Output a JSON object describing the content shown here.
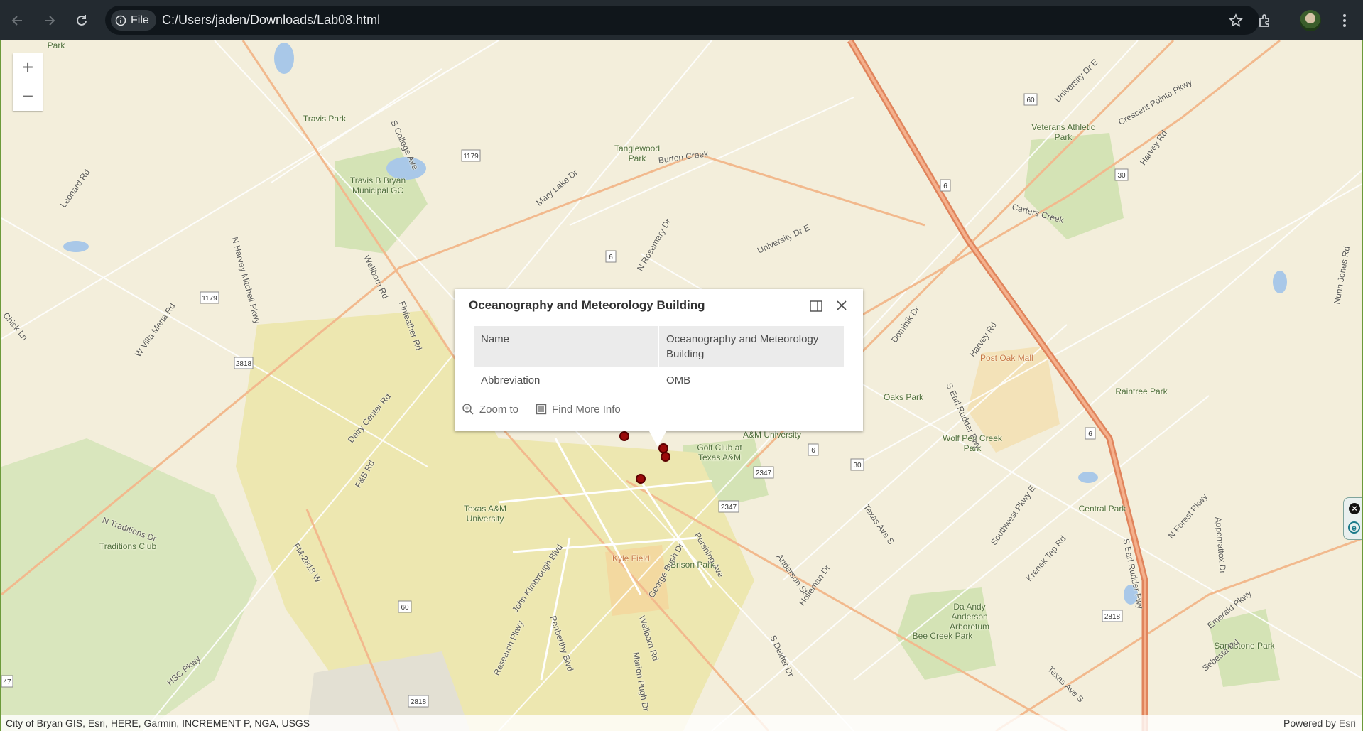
{
  "browser": {
    "site_chip_label": "File",
    "url": "C:/Users/jaden/Downloads/Lab08.html",
    "icons": [
      "back-icon",
      "forward-icon",
      "reload-icon",
      "info-icon",
      "bookmark-star-icon",
      "extensions-icon",
      "avatar",
      "kebab-menu-icon"
    ]
  },
  "map": {
    "zoom_in": "+",
    "zoom_out": "−",
    "labels": {
      "park1": "Park",
      "travis_park": "Travis Park",
      "travis_gc": "Travis B Bryan Municipal GC",
      "tanglewood": "Tanglewood Park",
      "veterans": "Veterans Athletic Park",
      "post_oak": "Post Oak Mall",
      "oaks_park": "Oaks Park",
      "raintree": "Raintree Park",
      "wolf_pen": "Wolf Pen Creek Park",
      "central": "Central Park",
      "golf": "Golf Club at Texas A&M",
      "am_univ": "A&M University",
      "tamu": "Texas A&M University",
      "kyle": "Kyle Field",
      "brison": "Brison Park",
      "traditions": "Traditions Club",
      "da_andy": "Da Andy Anderson Arboretum",
      "bee_creek": "Bee Creek Park",
      "sandstone": "Sandstone Park",
      "s_earl": "S Earl Rudder Fwy",
      "university_dr": "University Dr E",
      "harvey_rd": "Harvey Rd",
      "texas_ave": "Texas Ave S",
      "wellborn": "Wellborn Rd",
      "fm2818": "FM-2818 W",
      "college": "S College Ave",
      "villa_maria": "W Villa Maria Rd",
      "dairy_center": "Dairy Center Rd",
      "fb_rd": "F&B Rd",
      "traditions_dr": "N Traditions Dr",
      "john_k": "John Kimbrough Blvd",
      "george_bush": "George Bush Dr",
      "holleman": "Holleman Dr",
      "anderson": "Anderson St",
      "southwest_pkwy": "Southwest Pkwy E",
      "krenek": "Krenek Tap Rd",
      "carters": "Carters Creek",
      "burton": "Burton Creek",
      "leonard": "Leonard Rd",
      "mary_lake": "Mary Lake Dr",
      "rosemary": "N Rosemary Dr",
      "dartmouth": "Dominik Dr",
      "hsc": "HSC Pkwy",
      "chick_ln": "Chick Ln",
      "nunn_jones": "Nunn Jones Rd",
      "crescent": "Crescent Pointe Pkwy",
      "emerald": "Emerald Pkwy",
      "sebesta": "Sebesta Rd",
      "appomattox": "Appomattox Dr",
      "forest": "N Forest Pkwy",
      "pershing": "Pershing Ave",
      "dexter": "S Dexter Dr",
      "marion": "Marion Pugh Dr",
      "penberthy": "Penberthy Blvd",
      "research": "Research Pkwy",
      "harvey_mitchell": "N Harvey Mitchell Pkwy",
      "finfeather": "Finfeather Rd"
    },
    "shields": [
      "1179",
      "1179",
      "2818",
      "60",
      "6",
      "30",
      "2347",
      "2347",
      "6",
      "60",
      "2818",
      "2818",
      "30",
      "6",
      "47"
    ]
  },
  "popup": {
    "title": "Oceanography and Meteorology Building",
    "rows": [
      {
        "field": "Name",
        "value": "Oceanography and Meteorology Building"
      },
      {
        "field": "Abbreviation",
        "value": "OMB"
      }
    ],
    "zoom_to": "Zoom to",
    "find_more": "Find More Info"
  },
  "attribution": {
    "left": "City of Bryan GIS, Esri, HERE, Garmin, INCREMENT P, NGA, USGS",
    "powered_by": "Powered by",
    "esri": "Esri"
  },
  "extension_widget": {
    "close": "×",
    "e": "e"
  },
  "colors": {
    "map_bg": "#f3eedb",
    "park_green": "#d4e3b5",
    "campus_yellow": "#ede7b0",
    "highway": "#e89a74",
    "road": "#ffffff",
    "marker": "#9b0b0b",
    "browser_bar": "#232a30"
  }
}
